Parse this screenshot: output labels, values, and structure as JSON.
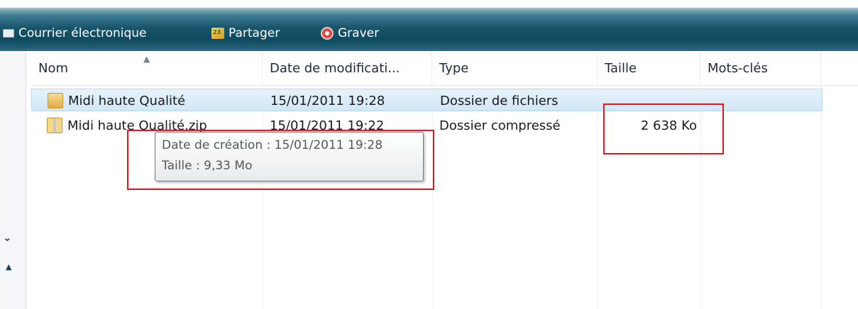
{
  "toolbar": {
    "items": [
      {
        "label": "Courrier électronique",
        "icon": "email-icon"
      },
      {
        "label": "Partager",
        "icon": "share-icon"
      },
      {
        "label": "Graver",
        "icon": "burn-disc-icon"
      }
    ]
  },
  "columns": [
    "Nom",
    "Date de modificati...",
    "Type",
    "Taille",
    "Mots-clés"
  ],
  "rows": [
    {
      "name": "Midi haute Qualité",
      "date": "15/01/2011 19:28",
      "type": "Dossier de fichiers",
      "size": "",
      "selected": true,
      "icon": "folder-icon"
    },
    {
      "name": "Midi haute Qualité.zip",
      "date": "15/01/2011 19:22",
      "type": "Dossier compressé",
      "size": "2 638 Ko",
      "selected": false,
      "icon": "zip-folder-icon"
    }
  ],
  "tooltip": {
    "line1": "Date de création : 15/01/2011 19:28",
    "line2": "Taille : 9,33 Mo"
  },
  "colors": {
    "toolbar": "#17546a",
    "selection": "#d2e7f7",
    "highlight_box": "#e5161b"
  }
}
